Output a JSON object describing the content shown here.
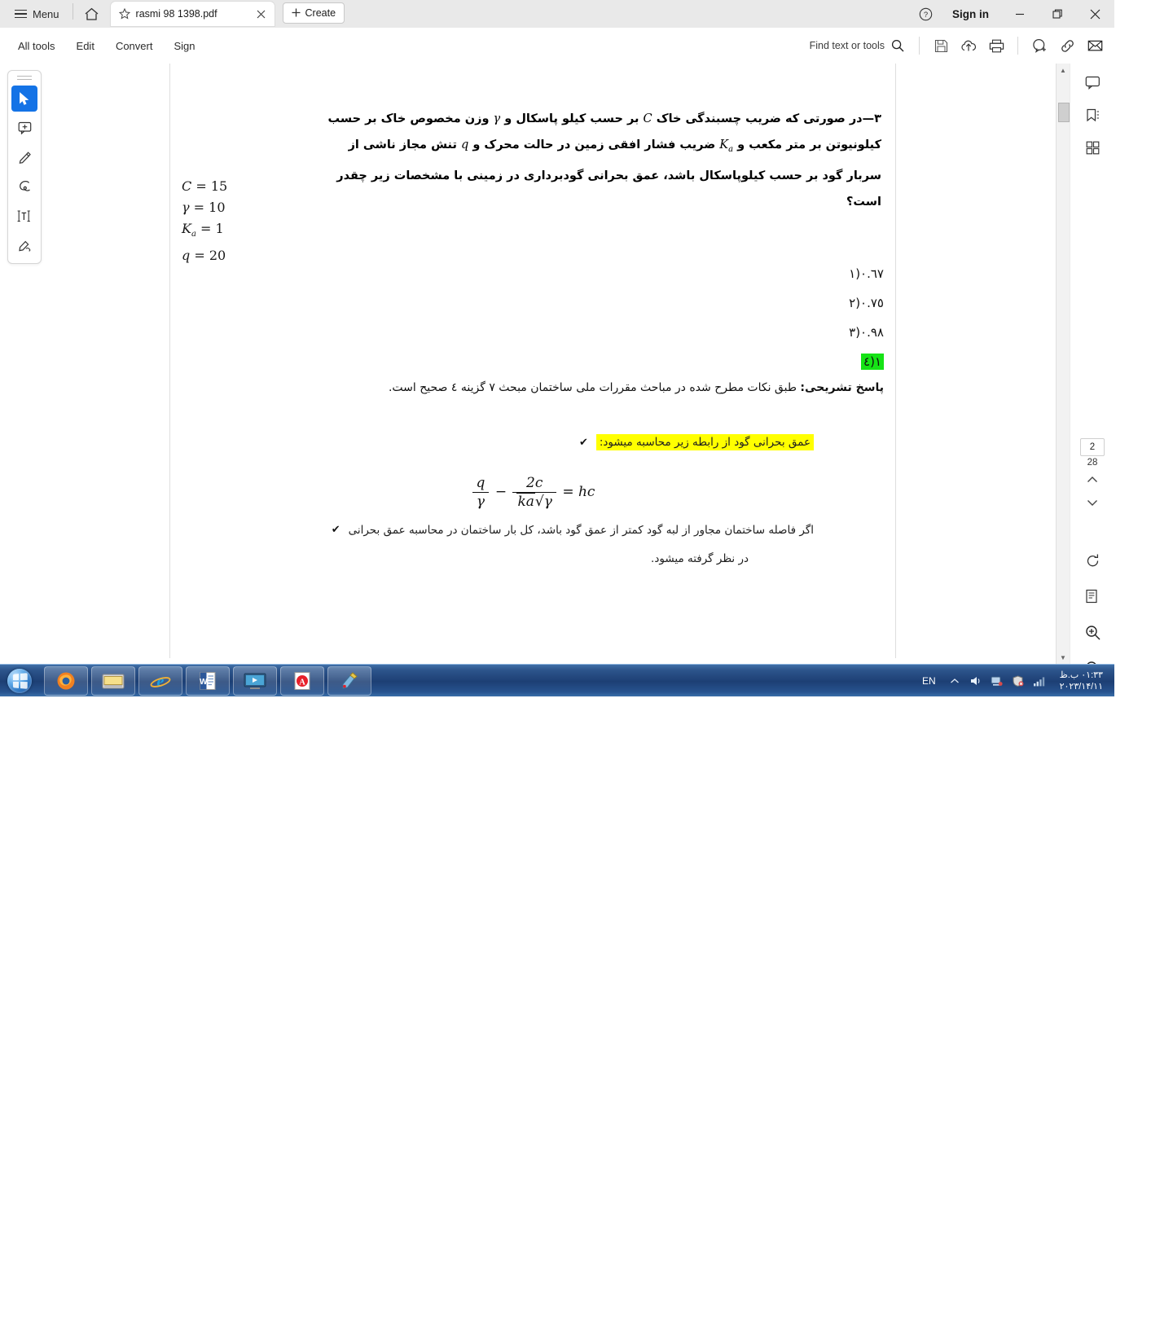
{
  "window": {
    "menu_label": "Menu",
    "signin_label": "Sign in",
    "tab_title": "rasmi 98 1398.pdf",
    "create_label": "Create",
    "icons": {
      "hamburger": "hamburger-icon",
      "home": "home-icon",
      "star": "star-icon",
      "close_tab": "close-icon",
      "plus": "plus-icon",
      "help": "help-icon",
      "minimize": "minimize-icon",
      "restore": "restore-icon",
      "close": "close-icon"
    }
  },
  "toolbar": {
    "items": [
      {
        "label": "All tools"
      },
      {
        "label": "Edit"
      },
      {
        "label": "Convert"
      },
      {
        "label": "Sign"
      }
    ],
    "find_placeholder": "Find text or tools",
    "right_icons": [
      "search-icon",
      "save-icon",
      "cloud-upload-icon",
      "print-icon",
      "add-comment-icon",
      "link-icon",
      "email-icon"
    ]
  },
  "left_rail": {
    "tools": [
      "select-tool",
      "add-comment-tool",
      "highlight-tool",
      "draw-tool",
      "add-text-tool",
      "fill-sign-tool"
    ]
  },
  "right_rail": {
    "tools": [
      "comment-panel-icon",
      "bookmark-icon",
      "thumbnails-icon"
    ],
    "page_current": "2",
    "page_total": "28",
    "nav_up": "chevron-up-icon",
    "nav_down": "chevron-down-icon",
    "lower_tools": [
      "rotate-icon",
      "page-view-icon",
      "zoom-in-icon",
      "zoom-out-icon"
    ]
  },
  "document": {
    "question_number": "۳—",
    "question_parts": {
      "p1": "در صورتی که ضریب چسبندگی خاک",
      "sym_c": "C",
      "p2": "بر حسب کیلو پاسکال و",
      "sym_gamma": "γ",
      "p3": "وزن مخصوص خاک بر حسب کیلونیوتن بر متر مکعب و",
      "sym_ka": "K",
      "sym_ka_sub": "a",
      "p4": "ضریب فشار افقی زمین در حالت محرک و",
      "sym_q": "q",
      "p5": "تنش مجاز ناشی از سربار گود بر حسب کیلوپاسکال باشد، عمق بحرانی گودبرداری در زمینی با مشخصات زیر چقدر است؟"
    },
    "givens": [
      {
        "symbol": "C",
        "sub": "",
        "value": "15"
      },
      {
        "symbol": "γ",
        "sub": "",
        "value": "10"
      },
      {
        "symbol": "K",
        "sub": "a",
        "value": "1"
      },
      {
        "symbol": "q",
        "sub": "",
        "value": "20"
      }
    ],
    "options": [
      {
        "number": "۱",
        "value": "٠.٦٧",
        "highlighted": false
      },
      {
        "number": "۲",
        "value": "٠.٧٥",
        "highlighted": false
      },
      {
        "number": "۳",
        "value": "٠.٩٨",
        "highlighted": false
      },
      {
        "number": "٤",
        "value": "۱",
        "highlighted": true
      }
    ],
    "answer_label": "پاسخ تشریحی:",
    "answer_text": "طبق نکات مطرح شده در مباحث مقررات ملی ساختمان مبحث ۷ گزینه ٤ صحیح است.",
    "bullet1": "عمق بحرانی گود از رابطه زیر محاسبه میشود:",
    "formula": {
      "lhs": "hc",
      "eq": "=",
      "term1_num": "2c",
      "term1_den_gamma": "γ",
      "term1_den_root": "ka",
      "minus": "−",
      "term2_num": "q",
      "term2_den": "γ"
    },
    "bullet2": "اگر فاصله ساختمان مجاور از لبه گود کمتر از عمق گود باشد، کل بار ساختمان در محاسبه عمق بحرانی",
    "bullet3": "در نظر گرفته میشود.",
    "check_glyph": "✔",
    "highlight_color": "#ffff00",
    "answer_highlight_color": "#16e316"
  },
  "taskbar": {
    "start": "start-orb",
    "apps": [
      "firefox-icon",
      "explorer-folder-icon",
      "internet-explorer-icon",
      "word-icon",
      "media-icon",
      "acrobat-icon",
      "paint-icon"
    ],
    "language": "EN",
    "tray_icons": [
      "show-hidden-icon",
      "volume-icon",
      "network-icon",
      "security-icon",
      "signal-icon"
    ],
    "time": "۰۱:۳۳ ب.ظ",
    "date": "۲۰۲۳/۱۴/۱۱"
  }
}
